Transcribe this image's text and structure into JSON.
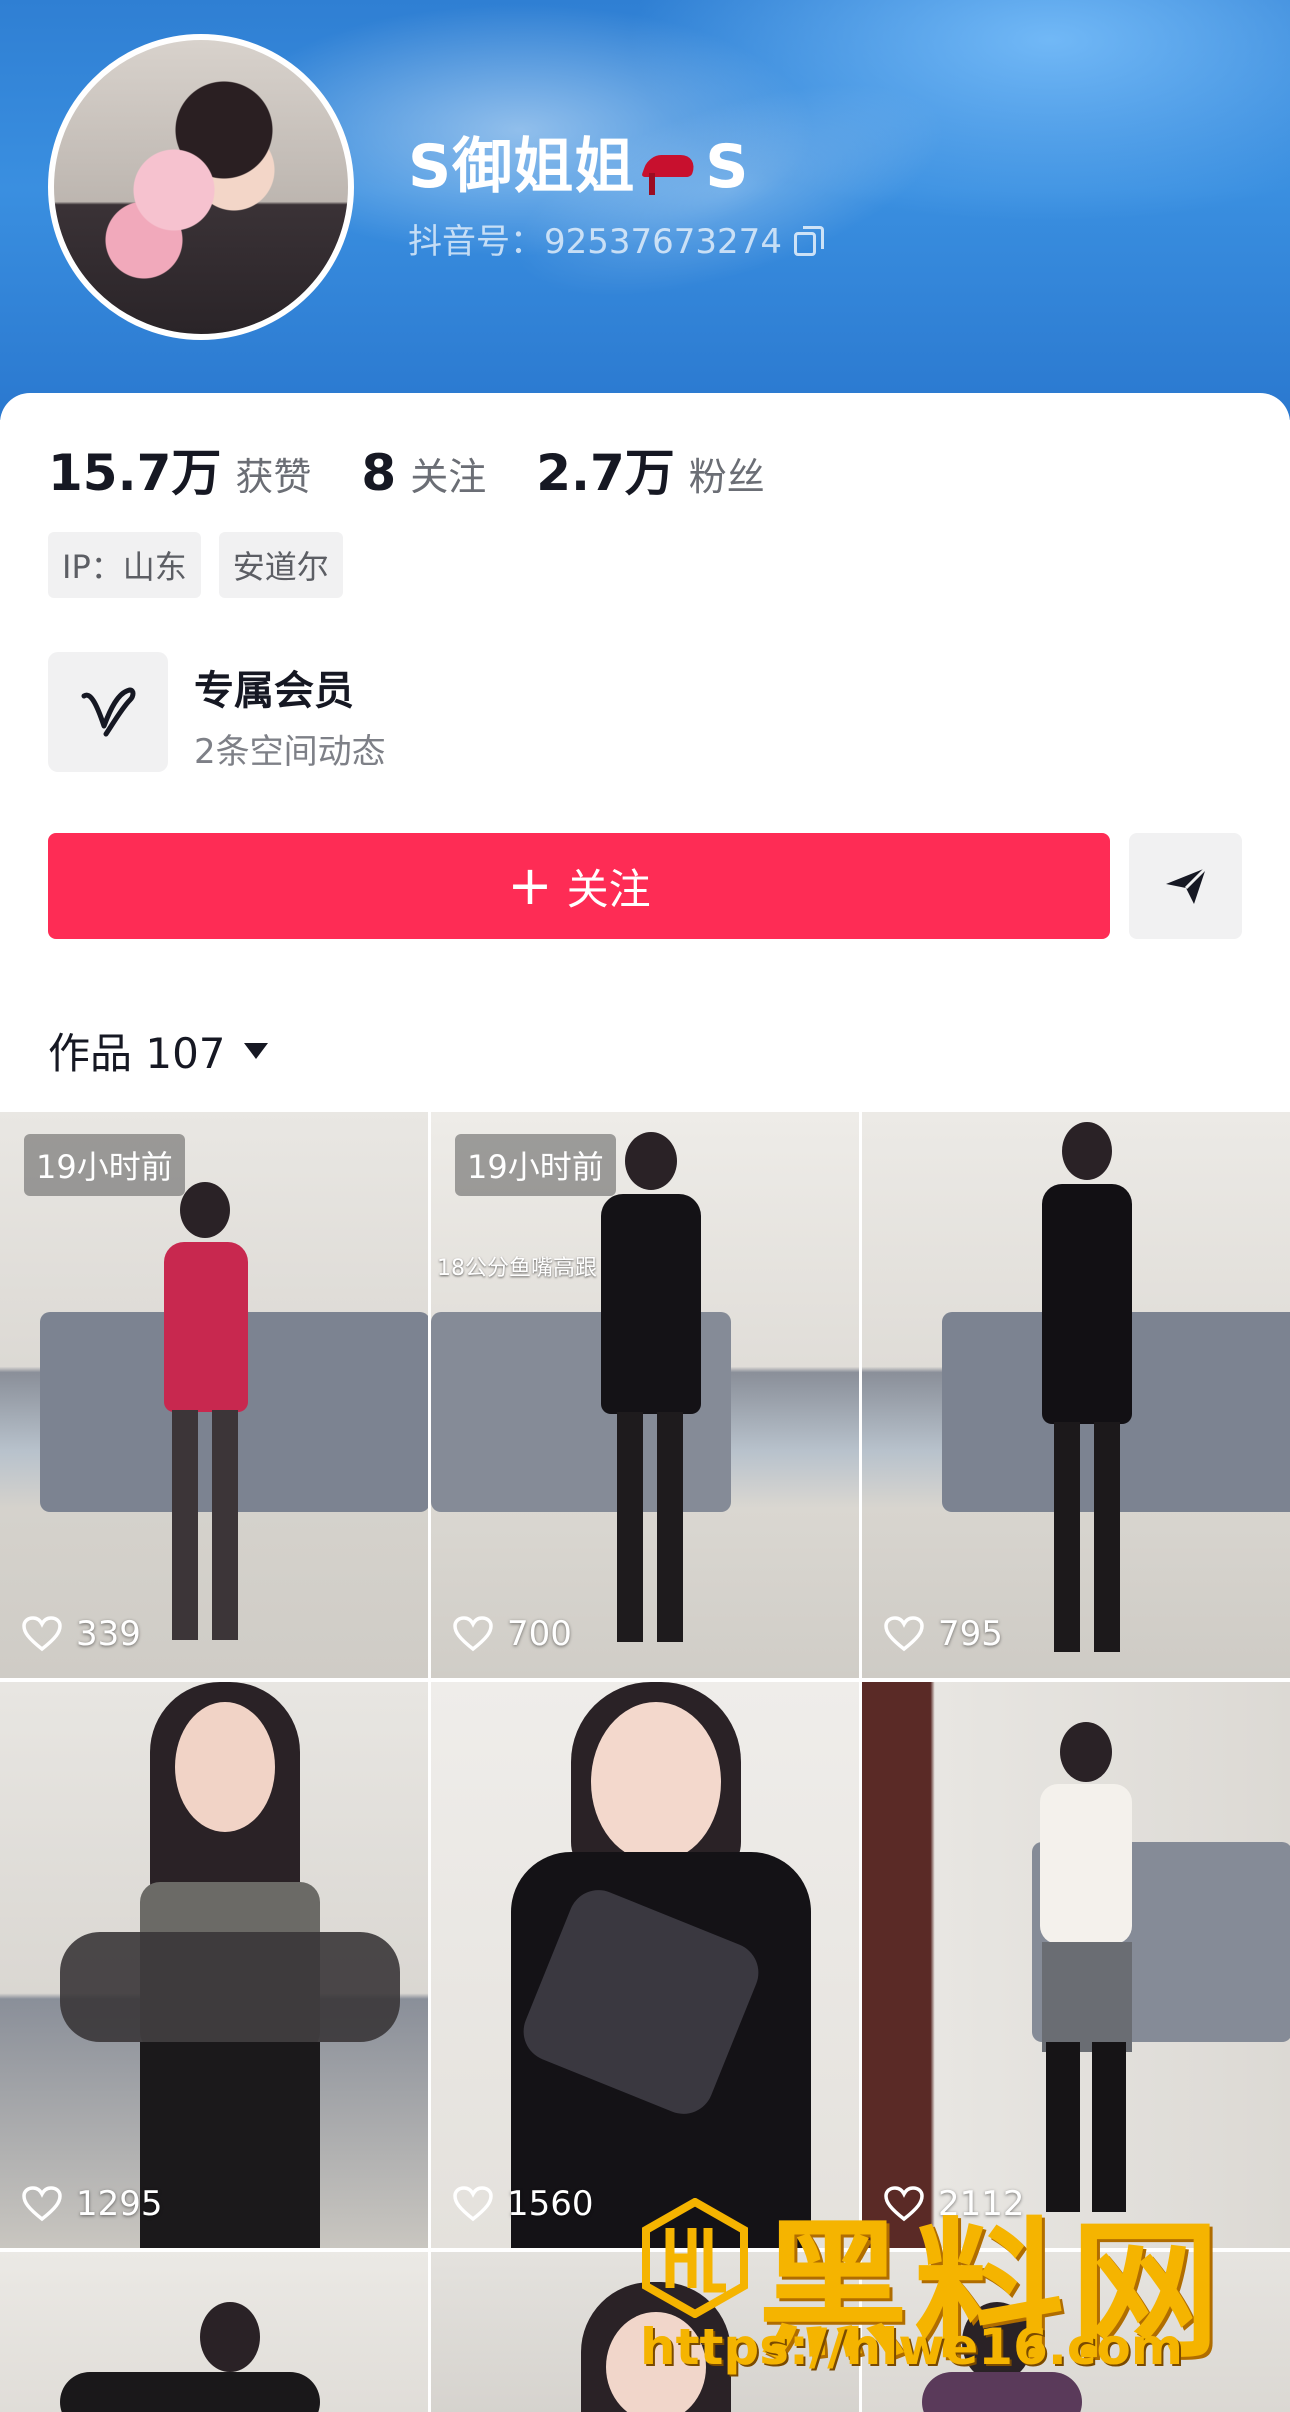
{
  "profile": {
    "nickname_prefix": "S御姐姐",
    "nickname_suffix": "S",
    "douyin_id": "抖音号：92537673274"
  },
  "stats": [
    {
      "num": "15.7万",
      "label": "获赞"
    },
    {
      "num": "8",
      "label": "关注"
    },
    {
      "num": "2.7万",
      "label": "粉丝"
    }
  ],
  "tags": [
    "IP：山东",
    "安道尔"
  ],
  "member": {
    "title": "专属会员",
    "subtitle": "2条空间动态"
  },
  "actions": {
    "follow_label": "关注",
    "follow_plus": "+"
  },
  "works": {
    "tab_label": "作品 107"
  },
  "videos": [
    {
      "badge": "19小时前",
      "likes": "339",
      "overlay": ""
    },
    {
      "badge": "19小时前",
      "likes": "700",
      "overlay": "18公分鱼嘴高跟"
    },
    {
      "badge": "",
      "likes": "795",
      "overlay": ""
    },
    {
      "badge": "",
      "likes": "1295",
      "overlay": ""
    },
    {
      "badge": "",
      "likes": "1560",
      "overlay": ""
    },
    {
      "badge": "",
      "likes": "2112",
      "overlay": ""
    }
  ],
  "watermark": {
    "text": "黑料网",
    "url": "https://hlwe16.com"
  },
  "colors": {
    "follow_button": "#fe2c55",
    "banner": "#2f7fd3",
    "watermark": "#f5b400"
  }
}
